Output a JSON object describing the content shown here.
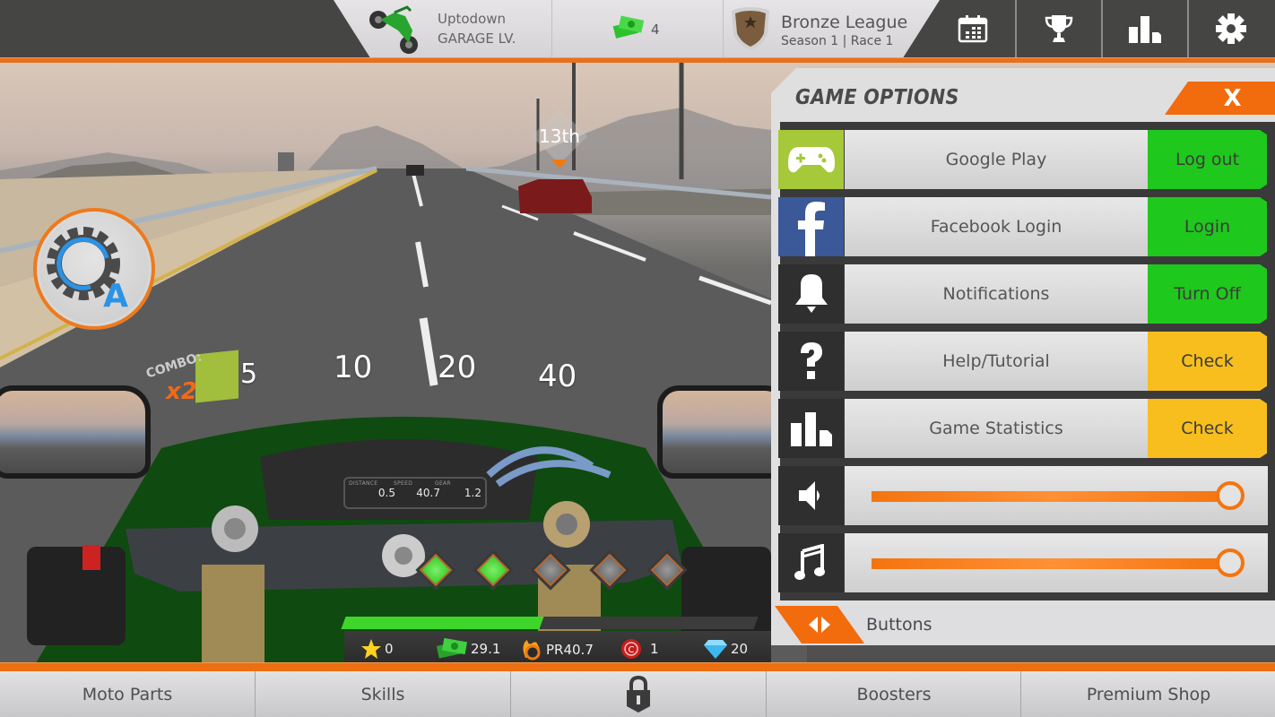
{
  "topbar": {
    "garage": {
      "name": "Uptodown",
      "level_label": "GARAGE LV.",
      "icon": "dirt-bike-icon"
    },
    "cash": {
      "count": "4",
      "icon": "cash-icon"
    },
    "league": {
      "name": "Bronze League",
      "subtitle": "Season 1 | Race 1",
      "icon": "bronze-shield-icon"
    },
    "buttons": [
      {
        "name": "calendar",
        "icon": "calendar-icon"
      },
      {
        "name": "trophy",
        "icon": "trophy-icon"
      },
      {
        "name": "leaderboard",
        "icon": "bar-chart-icon"
      },
      {
        "name": "settings",
        "icon": "gear-icon"
      }
    ]
  },
  "game": {
    "race_position": "13th",
    "combo_label": "COMBO:",
    "combo_multiplier": "x2",
    "speed_ticks": [
      "5",
      "10",
      "20",
      "40"
    ],
    "auto_button": {
      "icon": "auto-gear-icon",
      "letter": "A"
    },
    "dashboard": {
      "distance_label": "DISTANCE",
      "distance": "0.5",
      "speed_label": "SPEED",
      "speed": "40.7",
      "gear_label": "GEAR",
      "gear": "1.2"
    },
    "gems": {
      "lit": 2,
      "total": 5
    },
    "boost_fraction": 0.48,
    "hud": {
      "stars": "0",
      "cash": "29.1",
      "pr": "PR40.7",
      "coins": "1",
      "diamonds": "20"
    }
  },
  "options": {
    "title": "GAME OPTIONS",
    "close_label": "X",
    "rows": [
      {
        "label": "Google Play",
        "action": "Log out",
        "icon": "gamepad-icon",
        "icon_bg": "#a6c93a",
        "action_color": "#1fc81c"
      },
      {
        "label": "Facebook Login",
        "action": "Login",
        "icon": "facebook-icon",
        "icon_bg": "#3b5998",
        "action_color": "#1fc81c"
      },
      {
        "label": "Notifications",
        "action": "Turn Off",
        "icon": "bell-icon",
        "icon_bg": "#2f2f2f",
        "action_color": "#1fc81c"
      },
      {
        "label": "Help/Tutorial",
        "action": "Check",
        "icon": "question-icon",
        "icon_bg": "#2f2f2f",
        "action_color": "#f7be1e"
      },
      {
        "label": "Game Statistics",
        "action": "Check",
        "icon": "bar-chart-icon",
        "icon_bg": "#2f2f2f",
        "action_color": "#f7be1e"
      }
    ],
    "sliders": [
      {
        "name": "sound-volume",
        "icon": "speaker-icon",
        "value": 1.0
      },
      {
        "name": "music-volume",
        "icon": "music-note-icon",
        "value": 1.0
      }
    ],
    "footer_label": "Buttons"
  },
  "bottom_nav": {
    "tabs": [
      {
        "label": "Moto Parts"
      },
      {
        "label": "Skills"
      },
      {
        "label": "",
        "icon": "lock-icon",
        "locked": true
      },
      {
        "label": "Boosters"
      },
      {
        "label": "Premium Shop"
      }
    ]
  },
  "colors": {
    "accent_orange": "#f26b0d",
    "green_button": "#1fc81c",
    "yellow_button": "#f7be1e",
    "dark_bar": "#454644"
  }
}
